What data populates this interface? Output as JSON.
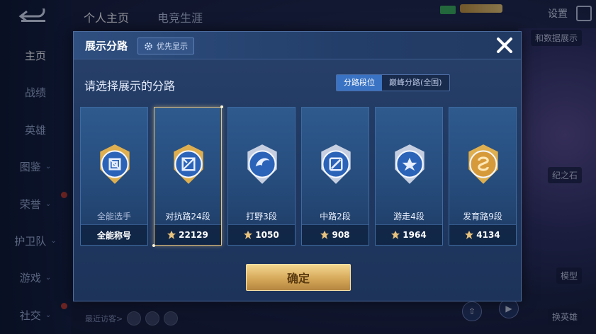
{
  "nav": {
    "items": [
      {
        "label": "主页",
        "active": true,
        "chevron": false,
        "dot": false
      },
      {
        "label": "战绩",
        "active": false,
        "chevron": false,
        "dot": false
      },
      {
        "label": "英雄",
        "active": false,
        "chevron": false,
        "dot": false
      },
      {
        "label": "图鉴",
        "active": false,
        "chevron": true,
        "dot": false
      },
      {
        "label": "荣誉",
        "active": false,
        "chevron": true,
        "dot": true
      },
      {
        "label": "护卫队",
        "active": false,
        "chevron": true,
        "dot": false
      },
      {
        "label": "游戏",
        "active": false,
        "chevron": true,
        "dot": false
      },
      {
        "label": "社交",
        "active": false,
        "chevron": true,
        "dot": true
      }
    ]
  },
  "top": {
    "tabs": [
      "个人主页",
      "电竞生涯"
    ],
    "settings_label": "设置"
  },
  "background": {
    "recent_visitors": "最近访客>",
    "right_labels": [
      "和数据展示",
      "纪之石",
      "模型",
      "换英雄"
    ]
  },
  "modal": {
    "title": "展示分路",
    "priority_label": "优先显示",
    "prompt": "请选择展示的分路",
    "segments": [
      {
        "label": "分路段位",
        "active": true
      },
      {
        "label": "巅峰分路(全国)",
        "active": false
      }
    ],
    "cards": [
      {
        "name": "全能选手",
        "footer": "全能称号",
        "points": null,
        "selected": false,
        "icon": "all-round-emblem-icon",
        "muted": true,
        "accent": "#e9b44c"
      },
      {
        "name": "对抗路24段",
        "footer": null,
        "points": "22129",
        "selected": true,
        "icon": "clash-lane-emblem-icon",
        "muted": false,
        "accent": "#e9b44c"
      },
      {
        "name": "打野3段",
        "footer": null,
        "points": "1050",
        "selected": false,
        "icon": "jungle-emblem-icon",
        "muted": false,
        "accent": "#cfd6e6"
      },
      {
        "name": "中路2段",
        "footer": null,
        "points": "908",
        "selected": false,
        "icon": "mid-lane-emblem-icon",
        "muted": false,
        "accent": "#cfd6e6"
      },
      {
        "name": "游走4段",
        "footer": null,
        "points": "1964",
        "selected": false,
        "icon": "roam-emblem-icon",
        "muted": false,
        "accent": "#cfd6e6"
      },
      {
        "name": "发育路9段",
        "footer": null,
        "points": "4134",
        "selected": false,
        "icon": "farm-lane-emblem-icon",
        "muted": false,
        "accent": "#e9b44c"
      }
    ],
    "confirm_label": "确定"
  }
}
